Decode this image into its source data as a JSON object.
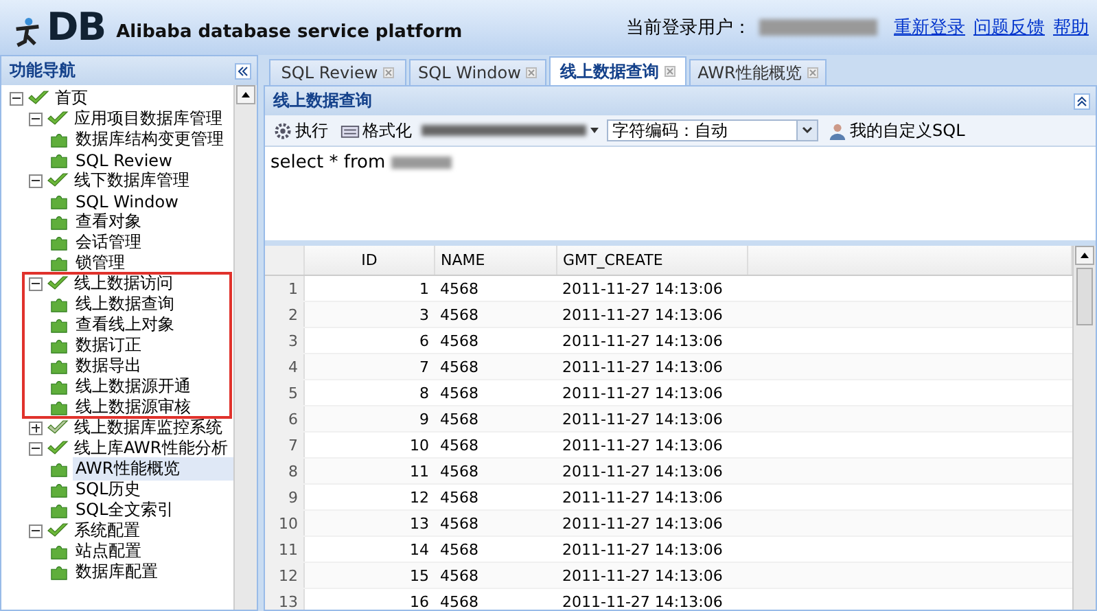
{
  "header": {
    "logo": "DB",
    "subtitle": "Alibaba database service platform",
    "user_label": "当前登录用户：",
    "links": [
      "重新登录",
      "问题反馈",
      "帮助"
    ]
  },
  "sidebar": {
    "title": "功能导航",
    "tree": [
      {
        "label": "首页",
        "expanded": true,
        "selected": false,
        "highlighted": false,
        "children": [
          {
            "label": "应用项目数据库管理",
            "expanded": true,
            "selected": false,
            "highlighted": false,
            "children": [
              {
                "label": "数据库结构变更管理",
                "selected": false,
                "highlighted": false
              },
              {
                "label": "SQL Review",
                "selected": false,
                "highlighted": false
              }
            ]
          },
          {
            "label": "线下数据库管理",
            "expanded": true,
            "selected": false,
            "highlighted": false,
            "children": [
              {
                "label": "SQL Window",
                "selected": false,
                "highlighted": false
              },
              {
                "label": "查看对象",
                "selected": false,
                "highlighted": false
              },
              {
                "label": "会话管理",
                "selected": false,
                "highlighted": false
              },
              {
                "label": "锁管理",
                "selected": false,
                "highlighted": false
              }
            ]
          },
          {
            "label": "线上数据访问",
            "expanded": true,
            "selected": false,
            "highlighted": true,
            "children": [
              {
                "label": "线上数据查询",
                "selected": false,
                "highlighted": false
              },
              {
                "label": "查看线上对象",
                "selected": false,
                "highlighted": false
              },
              {
                "label": "数据订正",
                "selected": false,
                "highlighted": false
              },
              {
                "label": "数据导出",
                "selected": false,
                "highlighted": false
              },
              {
                "label": "线上数据源开通",
                "selected": false,
                "highlighted": false
              },
              {
                "label": "线上数据源审核",
                "selected": false,
                "highlighted": false
              }
            ]
          },
          {
            "label": "线上数据库监控系统",
            "expanded": false,
            "selected": false,
            "highlighted": false
          },
          {
            "label": "线上库AWR性能分析",
            "expanded": true,
            "selected": false,
            "highlighted": false,
            "children": [
              {
                "label": "AWR性能概览",
                "selected": true,
                "highlighted": false
              },
              {
                "label": "SQL历史",
                "selected": false,
                "highlighted": false
              },
              {
                "label": "SQL全文索引",
                "selected": false,
                "highlighted": false
              }
            ]
          },
          {
            "label": "系统配置",
            "expanded": true,
            "selected": false,
            "highlighted": false,
            "children": [
              {
                "label": "站点配置",
                "selected": false,
                "highlighted": false
              },
              {
                "label": "数据库配置",
                "selected": false,
                "highlighted": false
              }
            ]
          }
        ]
      }
    ]
  },
  "tabs": [
    {
      "label": "SQL Review",
      "selected": false
    },
    {
      "label": "SQL Window",
      "selected": false
    },
    {
      "label": "线上数据查询",
      "selected": true
    },
    {
      "label": "AWR性能概览",
      "selected": false
    }
  ],
  "panel": {
    "title": "线上数据查询",
    "toolbar": {
      "run": "执行",
      "format": "格式化",
      "encoding": "字符编码：自动",
      "custom_sql": "我的自定义SQL"
    },
    "sql": "select * from"
  },
  "table": {
    "columns": [
      "ID",
      "NAME",
      "GMT_CREATE"
    ],
    "rows": [
      {
        "n": "1",
        "id": "1",
        "name": "4568",
        "created": "2011-11-27 14:13:06"
      },
      {
        "n": "2",
        "id": "3",
        "name": "4568",
        "created": "2011-11-27 14:13:06"
      },
      {
        "n": "3",
        "id": "6",
        "name": "4568",
        "created": "2011-11-27 14:13:06"
      },
      {
        "n": "4",
        "id": "7",
        "name": "4568",
        "created": "2011-11-27 14:13:06"
      },
      {
        "n": "5",
        "id": "8",
        "name": "4568",
        "created": "2011-11-27 14:13:06"
      },
      {
        "n": "6",
        "id": "9",
        "name": "4568",
        "created": "2011-11-27 14:13:06"
      },
      {
        "n": "7",
        "id": "10",
        "name": "4568",
        "created": "2011-11-27 14:13:06"
      },
      {
        "n": "8",
        "id": "11",
        "name": "4568",
        "created": "2011-11-27 14:13:06"
      },
      {
        "n": "9",
        "id": "12",
        "name": "4568",
        "created": "2011-11-27 14:13:06"
      },
      {
        "n": "10",
        "id": "13",
        "name": "4568",
        "created": "2011-11-27 14:13:06"
      },
      {
        "n": "11",
        "id": "14",
        "name": "4568",
        "created": "2011-11-27 14:13:06"
      },
      {
        "n": "12",
        "id": "15",
        "name": "4568",
        "created": "2011-11-27 14:13:06"
      },
      {
        "n": "13",
        "id": "16",
        "name": "4568",
        "created": "2011-11-27 14:13:06"
      }
    ]
  }
}
